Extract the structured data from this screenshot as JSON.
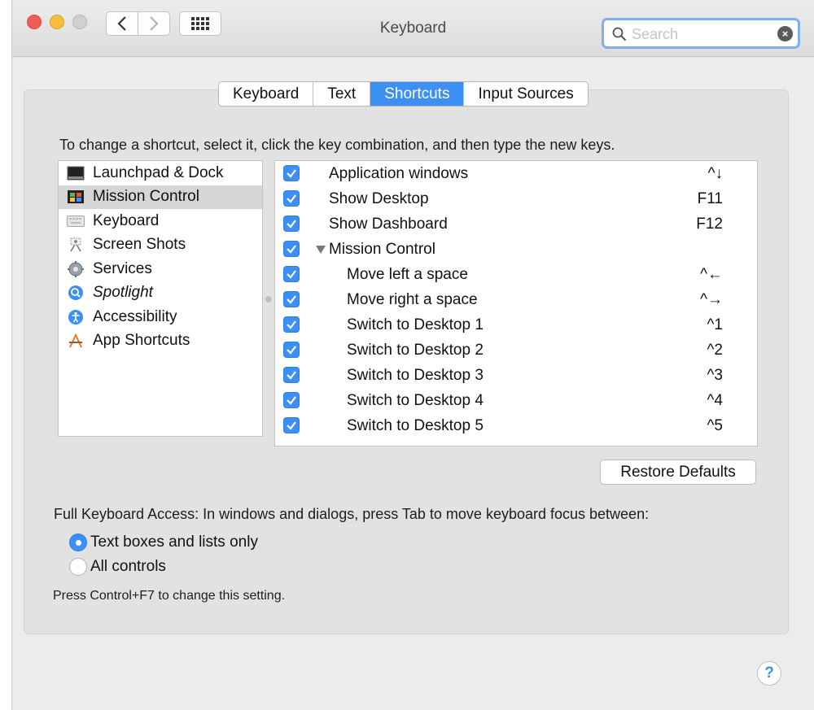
{
  "window": {
    "title": "Keyboard"
  },
  "search": {
    "placeholder": "Search",
    "value": ""
  },
  "tabs": [
    {
      "label": "Keyboard",
      "active": false
    },
    {
      "label": "Text",
      "active": false
    },
    {
      "label": "Shortcuts",
      "active": true
    },
    {
      "label": "Input Sources",
      "active": false
    }
  ],
  "instructions": "To change a shortcut, select it, click the key combination, and then type the new keys.",
  "categories": [
    {
      "label": "Launchpad & Dock",
      "icon": "launchpad-dock-icon",
      "selected": false
    },
    {
      "label": "Mission Control",
      "icon": "mission-control-icon",
      "selected": true
    },
    {
      "label": "Keyboard",
      "icon": "keyboard-icon",
      "selected": false
    },
    {
      "label": "Screen Shots",
      "icon": "screenshot-icon",
      "selected": false
    },
    {
      "label": "Services",
      "icon": "gear-icon",
      "selected": false
    },
    {
      "label": "Spotlight",
      "icon": "spotlight-icon",
      "selected": false
    },
    {
      "label": "Accessibility",
      "icon": "accessibility-icon",
      "selected": false
    },
    {
      "label": "App Shortcuts",
      "icon": "app-store-icon",
      "selected": false
    }
  ],
  "shortcuts": [
    {
      "label": "Application windows",
      "key": "^↓",
      "checked": true
    },
    {
      "label": "Show Desktop",
      "key": "F11",
      "checked": true
    },
    {
      "label": "Show Dashboard",
      "key": "F12",
      "checked": true
    },
    {
      "label": "Mission Control",
      "key": "",
      "checked": true
    },
    {
      "label": "Move left a space",
      "key": "^←",
      "checked": true
    },
    {
      "label": "Move right a space",
      "key": "^→",
      "checked": true
    },
    {
      "label": "Switch to Desktop 1",
      "key": "^1",
      "checked": true
    },
    {
      "label": "Switch to Desktop 2",
      "key": "^2",
      "checked": true
    },
    {
      "label": "Switch to Desktop 3",
      "key": "^3",
      "checked": true
    },
    {
      "label": "Switch to Desktop 4",
      "key": "^4",
      "checked": true
    },
    {
      "label": "Switch to Desktop 5",
      "key": "^5",
      "checked": true
    }
  ],
  "restore_defaults": "Restore Defaults",
  "full_keyboard_access": {
    "label": "Full Keyboard Access: In windows and dialogs, press Tab to move keyboard focus between:",
    "options": [
      {
        "label": "Text boxes and lists only",
        "selected": true
      },
      {
        "label": "All controls",
        "selected": false
      }
    ],
    "hint": "Press Control+F7 to change this setting."
  },
  "help": "?",
  "colors": {
    "accent": "#3c8ff5",
    "close": "#f25b53",
    "minimize": "#f7be3c"
  }
}
